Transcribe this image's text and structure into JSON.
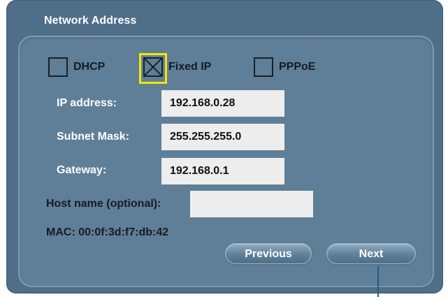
{
  "dialog": {
    "title": "Network Address"
  },
  "modes": [
    {
      "label": "DHCP",
      "checked": false
    },
    {
      "label": "Fixed IP",
      "checked": true
    },
    {
      "label": "PPPoE",
      "checked": false
    }
  ],
  "fields": {
    "ip": {
      "label": "IP address:",
      "value": "192.168.0.28"
    },
    "subnet": {
      "label": "Subnet Mask:",
      "value": "255.255.255.0"
    },
    "gateway": {
      "label": "Gateway:",
      "value": "192.168.0.1"
    },
    "host": {
      "label": "Host name (optional):",
      "value": ""
    }
  },
  "mac": "MAC: 00:0f:3d:f7:db:42",
  "buttons": {
    "previous": "Previous",
    "next": "Next"
  },
  "colors": {
    "background": "#4f6e87",
    "panel": "#5f7f98",
    "focus": "#f2e600"
  }
}
